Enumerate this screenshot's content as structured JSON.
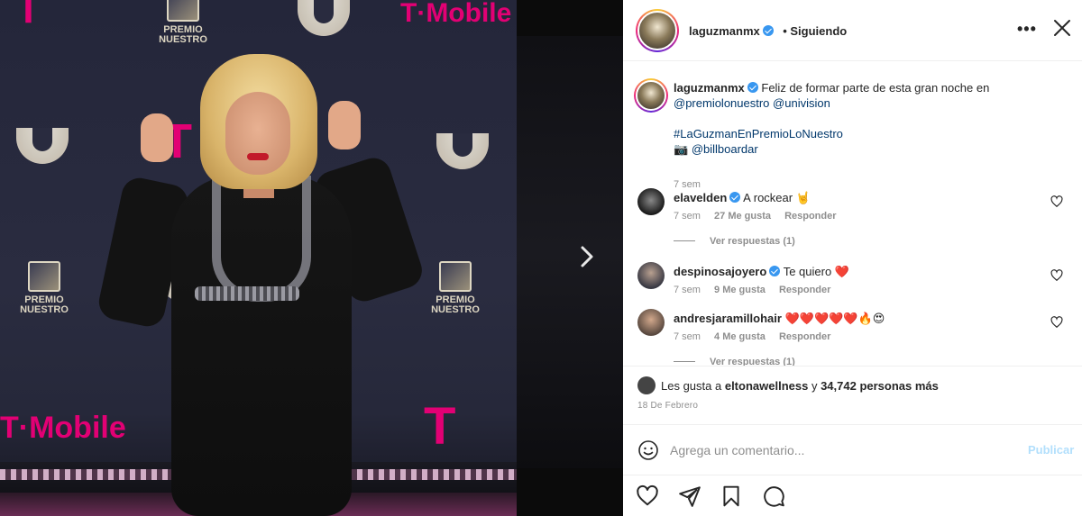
{
  "photo": {
    "brand_tmobile": "T·Mobile",
    "brand_tmobile_letter": "T",
    "brand_premio_line1": "PREMIO",
    "brand_premio_line2": "NUESTRO",
    "brand_premio_lo": "LO"
  },
  "post": {
    "author": "laguzmanmx",
    "follow_status": "Siguiendo",
    "more_icon": "more-options-icon",
    "close_icon": "close-icon",
    "caption": {
      "text": "Feliz de formar parte de esta gran noche en",
      "mentions": [
        "@premiolonuestro",
        "@univision"
      ],
      "hashtag": "#LaGuzmanEnPremioLoNuestro",
      "camera": "📷",
      "credit": "@billboardar",
      "time": "7 sem"
    },
    "comments": [
      {
        "user": "elavelden",
        "text": "A rockear 🤘",
        "time": "7 sem",
        "likes": "27 Me gusta",
        "reply": "Responder",
        "view_replies": "Ver respuestas (1)"
      },
      {
        "user": "despinosajoyero",
        "text": "Te quiero ❤️",
        "time": "7 sem",
        "likes": "9 Me gusta",
        "reply": "Responder"
      },
      {
        "user": "andresjaramillohair",
        "text": "❤️❤️❤️❤️❤️🔥😍",
        "time": "7 sem",
        "likes": "4 Me gusta",
        "reply": "Responder",
        "view_replies": "Ver respuestas (1)"
      }
    ],
    "likes": {
      "prefix": "Les gusta a",
      "user": "eltonawellness",
      "connector": "y",
      "others": "34,742 personas más"
    },
    "date": "18 De Febrero",
    "add_comment": {
      "placeholder": "Agrega un comentario...",
      "publish": "Publicar"
    }
  },
  "colors": {
    "verified": "#3897f0",
    "publish_disabled": "#b2dffc",
    "tmobile_magenta": "#e20074"
  }
}
